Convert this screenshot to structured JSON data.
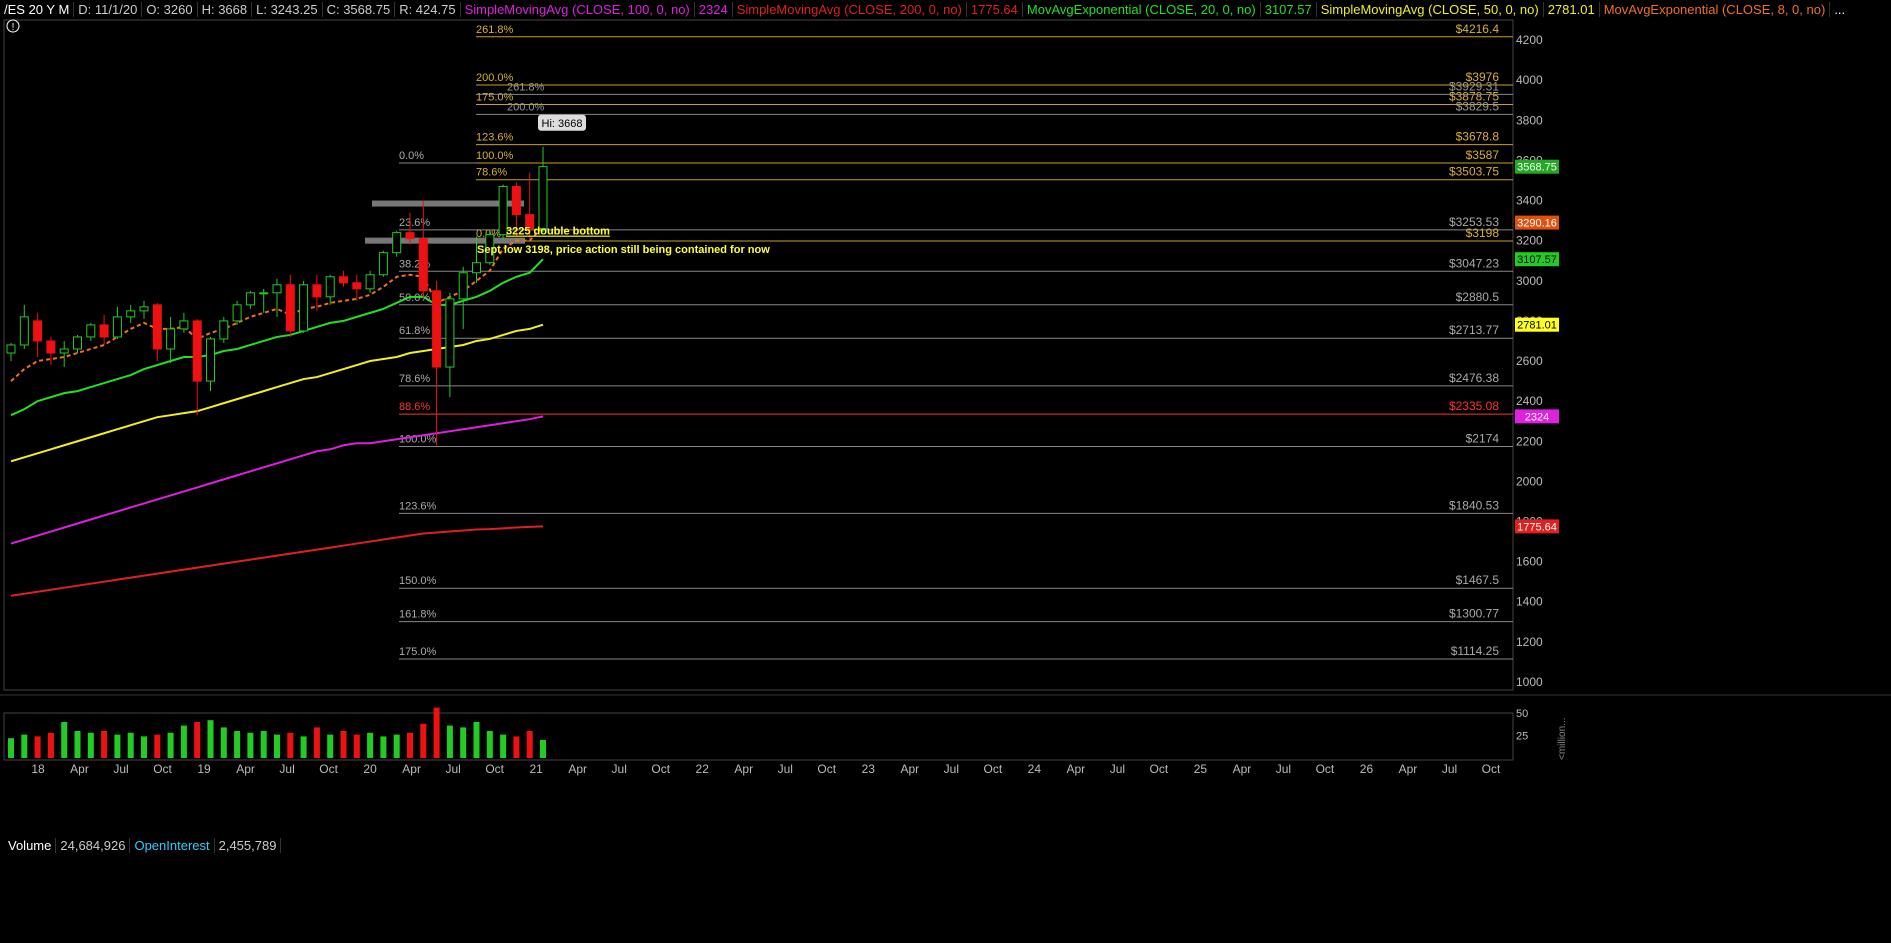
{
  "header": {
    "symbol": "/ES 20 Y M",
    "date": "D: 11/1/20",
    "open": "O: 3260",
    "high": "H: 3668",
    "low": "L: 3243.25",
    "close": "C: 3568.75",
    "range": "R: 424.75",
    "studies": [
      {
        "label": "SimpleMovingAvg (CLOSE, 100, 0, no)",
        "value": "2324",
        "color": "#e01ee0"
      },
      {
        "label": "SimpleMovingAvg (CLOSE, 200, 0, no)",
        "value": "1775.64",
        "color": "#e02020"
      },
      {
        "label": "MovAvgExponential (CLOSE, 20, 0, no)",
        "value": "3107.57",
        "color": "#22e022"
      },
      {
        "label": "SimpleMovingAvg (CLOSE, 50, 0, no)",
        "value": "2781.01",
        "color": "#f0f020"
      },
      {
        "label": "MovAvgExponential (CLOSE, 8, 0, no)",
        "value": "",
        "color": "#f07020"
      }
    ],
    "more": "..."
  },
  "colors": {
    "up": "#22cc22",
    "down": "#ee1111",
    "bg": "#000000",
    "grid": "#555555"
  },
  "chart_data": {
    "type": "line",
    "title": "",
    "y_ticks": [
      1000,
      1200,
      1400,
      1600,
      1800,
      2000,
      2200,
      2400,
      2600,
      2800,
      3000,
      3200,
      3400,
      3600,
      3800,
      4000,
      4200
    ],
    "ylim": [
      960,
      4300
    ],
    "x_tick_labels": [
      "18",
      "Apr",
      "Jul",
      "Oct",
      "19",
      "Apr",
      "Jul",
      "Oct",
      "20",
      "Apr",
      "Jul",
      "Oct",
      "21",
      "Apr",
      "Jul",
      "Oct",
      "22",
      "Apr",
      "Jul",
      "Oct",
      "23",
      "Apr",
      "Jul",
      "Oct",
      "24",
      "Apr",
      "Jul",
      "Oct",
      "25",
      "Apr",
      "Jul",
      "Oct",
      "26",
      "Apr",
      "Jul",
      "Oct"
    ],
    "candles": [
      {
        "o": 2640,
        "h": 2690,
        "l": 2600,
        "c": 2680
      },
      {
        "o": 2680,
        "h": 2880,
        "l": 2660,
        "c": 2820
      },
      {
        "o": 2800,
        "h": 2840,
        "l": 2620,
        "c": 2700
      },
      {
        "o": 2700,
        "h": 2720,
        "l": 2580,
        "c": 2640
      },
      {
        "o": 2640,
        "h": 2700,
        "l": 2570,
        "c": 2660
      },
      {
        "o": 2660,
        "h": 2730,
        "l": 2640,
        "c": 2720
      },
      {
        "o": 2720,
        "h": 2790,
        "l": 2700,
        "c": 2780
      },
      {
        "o": 2780,
        "h": 2830,
        "l": 2680,
        "c": 2720
      },
      {
        "o": 2720,
        "h": 2870,
        "l": 2710,
        "c": 2820
      },
      {
        "o": 2820,
        "h": 2880,
        "l": 2790,
        "c": 2850
      },
      {
        "o": 2850,
        "h": 2900,
        "l": 2810,
        "c": 2870
      },
      {
        "o": 2880,
        "h": 2890,
        "l": 2600,
        "c": 2660
      },
      {
        "o": 2660,
        "h": 2820,
        "l": 2590,
        "c": 2760
      },
      {
        "o": 2760,
        "h": 2840,
        "l": 2740,
        "c": 2800
      },
      {
        "o": 2800,
        "h": 2810,
        "l": 2330,
        "c": 2500
      },
      {
        "o": 2500,
        "h": 2720,
        "l": 2450,
        "c": 2710
      },
      {
        "o": 2710,
        "h": 2820,
        "l": 2690,
        "c": 2800
      },
      {
        "o": 2800,
        "h": 2900,
        "l": 2780,
        "c": 2880
      },
      {
        "o": 2880,
        "h": 2950,
        "l": 2860,
        "c": 2940
      },
      {
        "o": 2940,
        "h": 2960,
        "l": 2840,
        "c": 2940
      },
      {
        "o": 2940,
        "h": 3010,
        "l": 2820,
        "c": 2980
      },
      {
        "o": 2980,
        "h": 3030,
        "l": 2720,
        "c": 2750
      },
      {
        "o": 2750,
        "h": 3000,
        "l": 2740,
        "c": 2980
      },
      {
        "o": 2980,
        "h": 3030,
        "l": 2850,
        "c": 2920
      },
      {
        "o": 2920,
        "h": 3030,
        "l": 2880,
        "c": 3020
      },
      {
        "o": 3020,
        "h": 3050,
        "l": 2970,
        "c": 2990
      },
      {
        "o": 2990,
        "h": 3030,
        "l": 2900,
        "c": 2960
      },
      {
        "o": 2960,
        "h": 3050,
        "l": 2940,
        "c": 3030
      },
      {
        "o": 3030,
        "h": 3150,
        "l": 3020,
        "c": 3140
      },
      {
        "o": 3140,
        "h": 3250,
        "l": 3120,
        "c": 3240
      },
      {
        "o": 3240,
        "h": 3340,
        "l": 3180,
        "c": 3210
      },
      {
        "o": 3210,
        "h": 3400,
        "l": 2910,
        "c": 2950
      },
      {
        "o": 2950,
        "h": 3000,
        "l": 2180,
        "c": 2570
      },
      {
        "o": 2570,
        "h": 2940,
        "l": 2420,
        "c": 2910
      },
      {
        "o": 2910,
        "h": 3070,
        "l": 2760,
        "c": 3040
      },
      {
        "o": 3040,
        "h": 3220,
        "l": 2990,
        "c": 3090
      },
      {
        "o": 3090,
        "h": 3250,
        "l": 3080,
        "c": 3230
      },
      {
        "o": 3230,
        "h": 3480,
        "l": 3200,
        "c": 3470
      },
      {
        "o": 3470,
        "h": 3490,
        "l": 3220,
        "c": 3330
      },
      {
        "o": 3330,
        "h": 3540,
        "l": 3210,
        "c": 3260
      },
      {
        "o": 3260,
        "h": 3668,
        "l": 3243,
        "c": 3568.75
      }
    ],
    "series": [
      {
        "name": "MovAvgExponential (CLOSE, 8, 0, no)",
        "color": "#f07020",
        "dashed": true,
        "values": [
          2500,
          2560,
          2600,
          2610,
          2620,
          2640,
          2660,
          2680,
          2720,
          2760,
          2790,
          2760,
          2760,
          2770,
          2710,
          2740,
          2760,
          2790,
          2820,
          2840,
          2860,
          2830,
          2860,
          2870,
          2890,
          2900,
          2910,
          2930,
          2970,
          3020,
          3030,
          3020,
          2890,
          2920,
          2950,
          3000,
          3050,
          3160,
          3200,
          3200,
          3270
        ]
      },
      {
        "name": "MovAvgExponential (CLOSE, 20, 0, no)",
        "color": "#22e022",
        "values": [
          2330,
          2360,
          2400,
          2420,
          2440,
          2450,
          2470,
          2490,
          2510,
          2530,
          2560,
          2580,
          2600,
          2620,
          2620,
          2630,
          2650,
          2660,
          2680,
          2700,
          2720,
          2730,
          2750,
          2770,
          2790,
          2800,
          2820,
          2840,
          2860,
          2890,
          2920,
          2920,
          2880,
          2880,
          2900,
          2920,
          2950,
          2990,
          3020,
          3040,
          3107.57
        ]
      },
      {
        "name": "SimpleMovingAvg (CLOSE, 50, 0, no)",
        "color": "#f0f020",
        "values": [
          2100,
          2120,
          2140,
          2160,
          2180,
          2200,
          2220,
          2240,
          2260,
          2280,
          2300,
          2320,
          2330,
          2340,
          2350,
          2370,
          2390,
          2410,
          2430,
          2450,
          2470,
          2490,
          2510,
          2520,
          2540,
          2560,
          2580,
          2600,
          2610,
          2620,
          2640,
          2650,
          2660,
          2670,
          2680,
          2700,
          2710,
          2730,
          2750,
          2760,
          2781.01
        ]
      },
      {
        "name": "SimpleMovingAvg (CLOSE, 100, 0, no)",
        "color": "#e01ee0",
        "values": [
          1690,
          1710,
          1730,
          1750,
          1770,
          1790,
          1810,
          1830,
          1850,
          1870,
          1890,
          1910,
          1930,
          1950,
          1970,
          1990,
          2010,
          2030,
          2050,
          2070,
          2090,
          2110,
          2130,
          2150,
          2160,
          2180,
          2190,
          2190,
          2200,
          2210,
          2220,
          2230,
          2240,
          2250,
          2260,
          2270,
          2280,
          2290,
          2300,
          2310,
          2324
        ]
      },
      {
        "name": "SimpleMovingAvg (CLOSE, 200, 0, no)",
        "color": "#e02020",
        "values": [
          1430,
          1440,
          1450,
          1460,
          1470,
          1480,
          1490,
          1500,
          1510,
          1520,
          1530,
          1540,
          1550,
          1560,
          1570,
          1580,
          1590,
          1600,
          1610,
          1620,
          1630,
          1640,
          1650,
          1660,
          1670,
          1680,
          1690,
          1700,
          1710,
          1720,
          1730,
          1740,
          1745,
          1750,
          1755,
          1760,
          1762,
          1766,
          1770,
          1773,
          1775.64
        ]
      }
    ],
    "fib_lower": [
      {
        "pct": "0.0%",
        "price": 3587,
        "label": ""
      },
      {
        "pct": "23.6%",
        "price": 3253.53,
        "label": "$3253.53"
      },
      {
        "pct": "38.2%",
        "price": 3047.23,
        "label": "$3047.23"
      },
      {
        "pct": "50.0%",
        "price": 2880.5,
        "label": "$2880.5"
      },
      {
        "pct": "61.8%",
        "price": 2713.77,
        "label": "$2713.77"
      },
      {
        "pct": "78.6%",
        "price": 2476.38,
        "label": "$2476.38"
      },
      {
        "pct": "88.6%",
        "price": 2335.08,
        "label": "$2335.08",
        "color": "#ff3333"
      },
      {
        "pct": "100.0%",
        "price": 2174,
        "label": "$2174"
      },
      {
        "pct": "123.6%",
        "price": 1840.53,
        "label": "$1840.53"
      },
      {
        "pct": "150.0%",
        "price": 1467.5,
        "label": "$1467.5"
      },
      {
        "pct": "161.8%",
        "price": 1300.77,
        "label": "$1300.77"
      },
      {
        "pct": "175.0%",
        "price": 1114.25,
        "label": "$1114.25"
      }
    ],
    "fib_upper": [
      {
        "pct": "261.8%",
        "price": 4216.4,
        "label": "$4216.4"
      },
      {
        "pct": "200.0%",
        "price": 3976,
        "label": "$3976"
      },
      {
        "pct": "175.0%",
        "price": 3878.75,
        "label": "$3878.75"
      },
      {
        "pct": "123.6%",
        "price": 3678.8,
        "label": "$3678.8"
      },
      {
        "pct": "100.0%",
        "price": 3587,
        "label": "$3587"
      },
      {
        "pct": "78.6%",
        "price": 3503.75,
        "label": "$3503.75"
      },
      {
        "pct": "0.0%",
        "price": 3198,
        "label": "$3198"
      }
    ],
    "fib_grey": [
      {
        "pct": "261.8%",
        "price": 3929.31,
        "label": "$3929.31"
      },
      {
        "pct": "200.0%",
        "price": 3829.5,
        "label": "$3829.5"
      }
    ],
    "annotations": {
      "hi_label": "Hi: 3668",
      "note1": "3225 double bottom",
      "note2": "Sept low 3198, price action still being contained for now"
    },
    "price_badges": [
      {
        "value": "3568.75",
        "price": 3568.75,
        "bg": "#22aa22",
        "fg": "#fff"
      },
      {
        "value": "3290.16",
        "price": 3290.16,
        "bg": "#e05010",
        "fg": "#fff"
      },
      {
        "value": "3107.57",
        "price": 3107.57,
        "bg": "#22cc22",
        "fg": "#000"
      },
      {
        "value": "2781.01",
        "price": 2781.01,
        "bg": "#ffff22",
        "fg": "#000"
      },
      {
        "value": "2324",
        "price": 2324,
        "bg": "#e020e0",
        "fg": "#fff"
      },
      {
        "value": "1775.64",
        "price": 1775.64,
        "bg": "#e02020",
        "fg": "#fff"
      }
    ],
    "volume": {
      "label": "Volume",
      "value": "24,684,926",
      "oi_label": "OpenInterest",
      "oi_value": "2,455,789",
      "y_ticks": [
        25,
        50
      ],
      "unit": "<million...",
      "values": [
        22,
        26,
        24,
        28,
        40,
        30,
        28,
        30,
        26,
        28,
        24,
        26,
        28,
        36,
        40,
        42,
        34,
        30,
        28,
        30,
        26,
        28,
        24,
        34,
        26,
        30,
        26,
        28,
        24,
        26,
        28,
        38,
        56,
        36,
        34,
        40,
        30,
        26,
        24,
        30,
        20
      ]
    }
  }
}
